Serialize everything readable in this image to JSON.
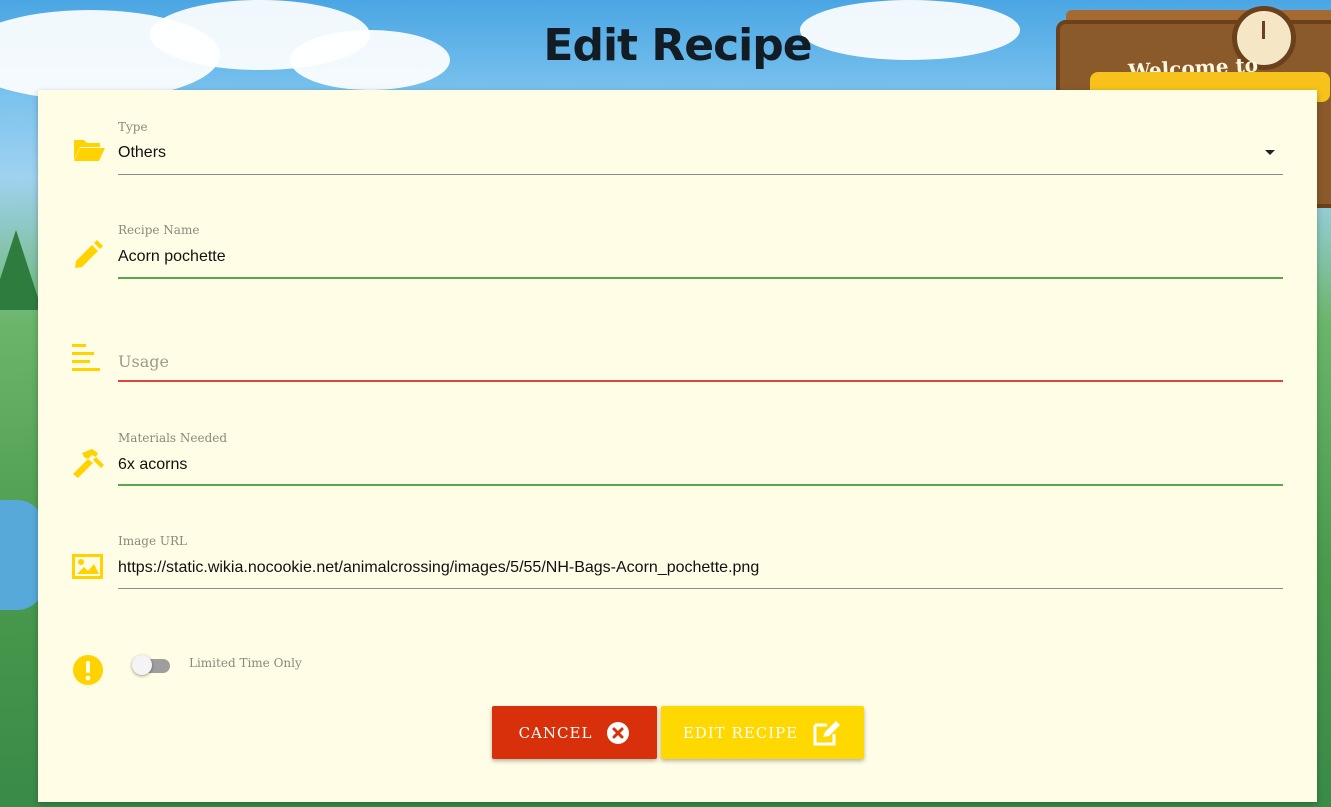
{
  "header": {
    "title": "Edit Recipe"
  },
  "background": {
    "sign_text": "Welcome to"
  },
  "form": {
    "type": {
      "label": "Type",
      "value": "Others",
      "icon": "folder-open-icon"
    },
    "recipe_name": {
      "label": "Recipe Name",
      "value": "Acorn pochette",
      "icon": "pencil-icon"
    },
    "usage": {
      "placeholder": "Usage",
      "value": "",
      "icon": "align-left-icon"
    },
    "materials": {
      "label": "Materials Needed",
      "value": "6x acorns",
      "icon": "hammer-icon"
    },
    "image_url": {
      "label": "Image URL",
      "value": "https://static.wikia.nocookie.net/animalcrossing/images/5/55/NH-Bags-Acorn_pochette.png",
      "icon": "image-icon"
    },
    "limited": {
      "label": "Limited Time Only",
      "checked": false,
      "icon": "exclamation-circle-icon"
    }
  },
  "actions": {
    "cancel_label": "CANCEL",
    "edit_label": "EDIT RECIPE"
  },
  "colors": {
    "accent": "#ffd800",
    "danger": "#d8300a",
    "panel": "#fffde6",
    "valid_line": "#5aa64f",
    "error_line": "#e0453a"
  }
}
